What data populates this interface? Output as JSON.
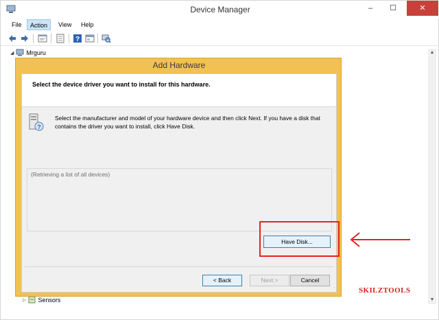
{
  "window": {
    "title": "Device Manager",
    "controls": {
      "minimize": "–",
      "maximize": "☐",
      "close": "✕"
    }
  },
  "menu": [
    "File",
    "Action",
    "View",
    "Help"
  ],
  "toolbar_icons": [
    "back-arrow-icon",
    "forward-arrow-icon",
    "properties-icon",
    "console-tree-icon",
    "help-icon",
    "window-icon",
    "scan-hardware-icon"
  ],
  "tree": {
    "root": "Mrguru",
    "last_item": "Sensors"
  },
  "dialog": {
    "title": "Add Hardware",
    "heading": "Select the device driver you want to install for this hardware.",
    "instructions": "Select the manufacturer and model of your hardware device and then click Next. If you have a disk that contains the driver you want to install, click Have Disk.",
    "list_status": "(Retrieving a list of all devices)",
    "have_disk": "Have Disk...",
    "back": "< Back",
    "next": "Next >",
    "cancel": "Cancel"
  },
  "watermark": "SKILZTOOLS",
  "colors": {
    "dialog_frame": "#f1c153",
    "highlight": "#e32222",
    "close_button": "#c7413a"
  }
}
